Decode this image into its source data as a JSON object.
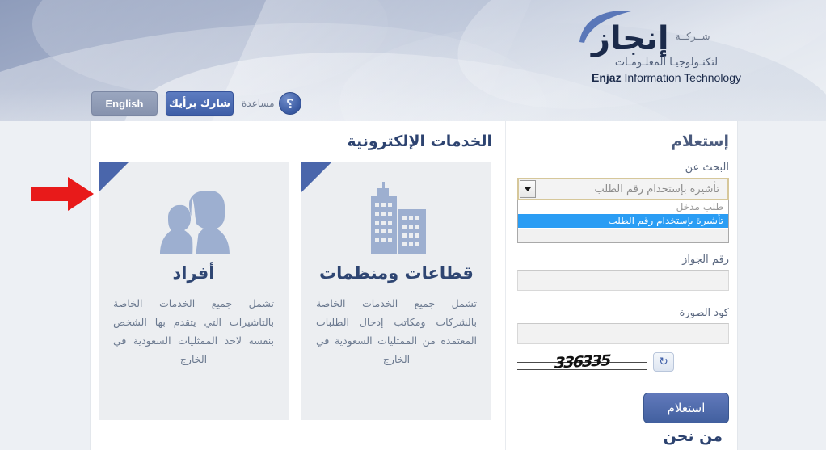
{
  "header": {
    "logo": {
      "brand_ar": "إنجاز",
      "prefix_ar": "شــركــة",
      "sub_ar": "لتكنـولوجيـا المعلـومـات",
      "brand_en_bold": "Enjaz",
      "brand_en_rest": " Information Technology"
    },
    "topbar": {
      "english_label": "English",
      "share_label": "شارك برأيك",
      "help_icon": "question-mark-icon",
      "help_glyph": "؟",
      "help_label": "مساعدة"
    }
  },
  "services": {
    "title": "الخدمات الإلكترونية",
    "cards": [
      {
        "icon": "people-icon",
        "title": "أفراد",
        "desc": "تشمل جميع الخدمات الخاصة بالتاشيرات التي يتقدم بها الشخص بنفسه لاحد الممثليات السعودية في الخارج"
      },
      {
        "icon": "buildings-icon",
        "title": "قطاعات ومنظمات",
        "desc": "تشمل جميع الخدمات الخاصة بالشركات ومكاتب إدخال الطلبات المعتمدة من الممثليات السعودية في الخارج"
      }
    ]
  },
  "inquiry": {
    "title": "إستعلام",
    "search_for": {
      "label": "البحث عن",
      "selected_value": "تأشيرة بإستخدام رقم الطلب",
      "expanded": true,
      "options": [
        {
          "label": "طلب مدخل",
          "selected": false
        },
        {
          "label": "تأشيرة بإستخدام رقم الطلب",
          "selected": true
        },
        {
          "label": "",
          "selected": false
        }
      ]
    },
    "passport": {
      "label": "رقم الجواز",
      "value": "",
      "placeholder": ""
    },
    "captcha": {
      "label": "كود الصورة",
      "value": "",
      "placeholder": "",
      "image_text": "336335",
      "refresh_icon": "refresh-icon",
      "refresh_glyph": "↻"
    },
    "submit_label": "استعلام"
  },
  "about": {
    "title": "من نحن"
  },
  "annotation": {
    "arrow": "red-arrow-pointing-right",
    "color": "#e81a1a"
  },
  "colors": {
    "accent_blue": "#4a66ab",
    "title_navy": "#2d4370",
    "highlight": "#2a9df4",
    "focus_border": "#d6c79a",
    "card_bg": "#eceef1"
  }
}
